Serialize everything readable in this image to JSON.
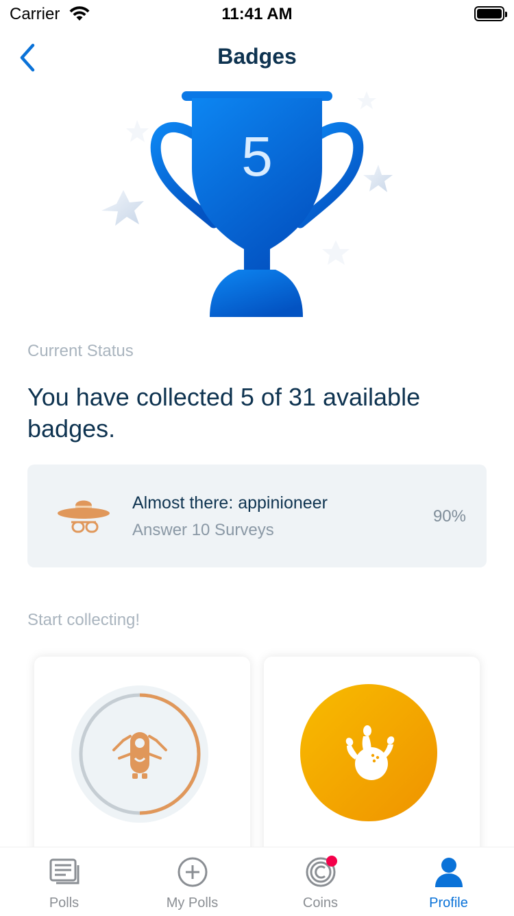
{
  "status_bar": {
    "carrier": "Carrier",
    "time": "11:41 AM"
  },
  "nav": {
    "title": "Badges",
    "back_icon": "chevron-left-icon"
  },
  "trophy": {
    "count": "5",
    "icon": "trophy-icon"
  },
  "current_status": {
    "label": "Current Status",
    "headline": "You have collected 5 of 31 available badges."
  },
  "almost_there": {
    "icon": "ranger-hat-glasses-icon",
    "title": "Almost there: appinioneer",
    "subtitle": "Answer 10 Surveys",
    "progress": "90%"
  },
  "start_collecting": {
    "label": "Start collecting!",
    "badges": [
      {
        "icon": "robot-icon",
        "progress_fraction": 0.5
      },
      {
        "icon": "bowling-icon"
      }
    ]
  },
  "colors": {
    "accent": "#0a72d8",
    "trophy": "#0a72d8",
    "badge_orange": "#e0975a",
    "bowling_gold": "#f5a800",
    "notification": "#f4004a"
  },
  "tabs": [
    {
      "label": "Polls",
      "icon": "polls-icon",
      "active": false
    },
    {
      "label": "My Polls",
      "icon": "add-circle-icon",
      "active": false
    },
    {
      "label": "Coins",
      "icon": "coin-icon",
      "active": false,
      "badge": true
    },
    {
      "label": "Profile",
      "icon": "profile-icon",
      "active": true
    }
  ]
}
